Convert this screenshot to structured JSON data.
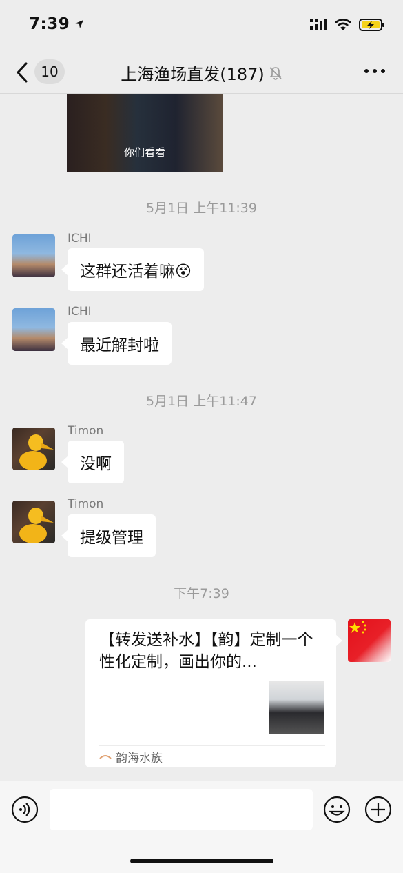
{
  "status_bar": {
    "time": "7:39"
  },
  "nav": {
    "back_count": "10",
    "title": "上海渔场直发(187)"
  },
  "messages": {
    "video_caption": "你们看看",
    "ts1": "5月1日 上午11:39",
    "m1_name": "ICHI",
    "m1_text": "这群还活着嘛😵",
    "m2_name": "ICHI",
    "m2_text": "最近解封啦",
    "ts2": "5月1日 上午11:47",
    "m3_name": "Timon",
    "m3_text": "没啊",
    "m4_name": "Timon",
    "m4_text": "提级管理",
    "ts3": "下午7:39"
  },
  "card": {
    "title": "【转发送补水】【韵】定制一个性化定制，画出你的...",
    "source": "韵海水族"
  },
  "colors": {
    "background": "#ededed",
    "bubble": "#ffffff",
    "battery": "#f5d21a"
  }
}
